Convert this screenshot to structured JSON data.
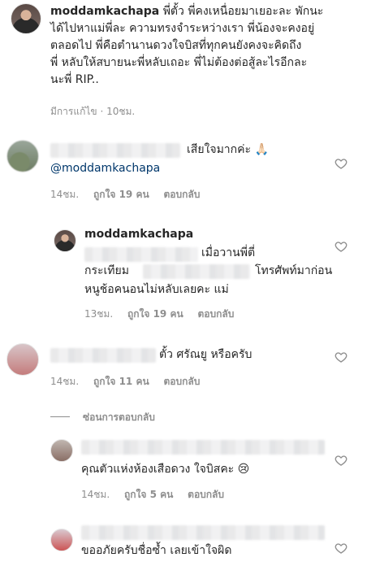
{
  "post": {
    "username": "moddamkachapa",
    "caption_lines": [
      "พี่ตั้ว พี่คงเหนื่อยมาเยอะละ พักนะ",
      "ได้ไปหาแม่พี่ละ ความทรงจำระหว่างเรา พี่น้องจะคงอยู่",
      "ตลอดไป พี่คือตำนานดวงใจบิสที่ทุกคนยังคงจะคิดถึง",
      "พี่ หลับให้สบายนะพี่หลับเถอะ พี่ไม่ต้องต่อสู้ละไรอีกละ",
      "นะพี่ RIP.."
    ],
    "edited": "มีการแก้ไข",
    "dot": "·",
    "time": "10ชม."
  },
  "comments": [
    {
      "text": "เสียใจมากค่ะ 🙏🏻",
      "mention": "@moddamkachapa",
      "time": "14ชม.",
      "likes": "ถูกใจ 19 คน",
      "reply": "ตอบกลับ"
    },
    {
      "username": "moddamkachapa",
      "text1": "เมื่อวานพี่ตี่",
      "text2a": "กระเทียม",
      "text2b": "โทรศัพท์มาก่อน",
      "text3": "หนูช้อคนอนไม่หลับเลยคะ แม่",
      "time": "13ชม.",
      "likes": "ถูกใจ 19 คน",
      "reply": "ตอบกลับ"
    },
    {
      "text": "ตั้ว ศรัณยู หรือครับ",
      "time": "14ชม.",
      "likes": "ถูกใจ 11 คน",
      "reply": "ตอบกลับ"
    },
    {
      "text": "คุณตัวแห่งห้องเสือดวง ใจบิสคะ 😢",
      "time": "14ชม.",
      "likes": "ถูกใจ 5 คน",
      "reply": "ตอบกลับ"
    },
    {
      "text": "ขออภัยครับชื่อซ้ำ เลยเข้าใจผิด"
    }
  ],
  "hide_replies": "ซ่อนการตอบกลับ"
}
